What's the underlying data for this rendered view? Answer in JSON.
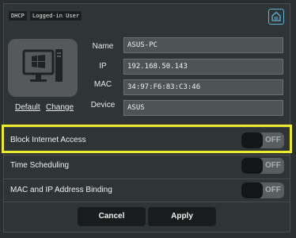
{
  "badges": [
    "DHCP",
    "Logged-in User"
  ],
  "icons": {
    "corner": "save-device-icon",
    "device": "windows-pc-icon"
  },
  "links": {
    "default": "Default",
    "change": "Change"
  },
  "fields": {
    "name": {
      "label": "Name",
      "value": "ASUS-PC"
    },
    "ip": {
      "label": "IP",
      "value": "192.168.50.143"
    },
    "mac": {
      "label": "MAC",
      "value": "34:97:F6:83:C3:46"
    },
    "device": {
      "label": "Device",
      "value": "ASUS"
    }
  },
  "settings": [
    {
      "label": "Block Internet Access",
      "state": "OFF"
    },
    {
      "label": "Time Scheduling",
      "state": "OFF"
    },
    {
      "label": "MAC and IP Address Binding",
      "state": "OFF"
    }
  ],
  "buttons": {
    "cancel": "Cancel",
    "apply": "Apply"
  },
  "colors": {
    "accent": "#5fb2d8",
    "highlight": "#ecec2c",
    "background": "#2f3437"
  }
}
